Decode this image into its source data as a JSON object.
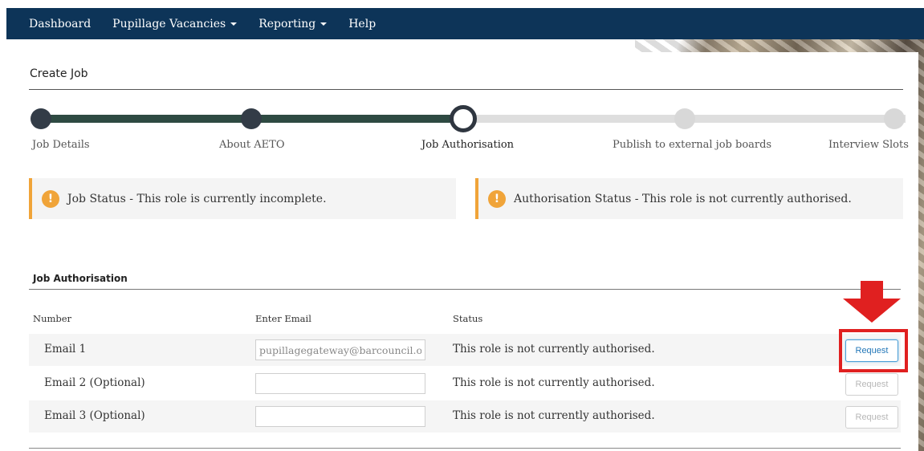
{
  "nav": {
    "items": [
      {
        "label": "Dashboard",
        "dropdown": false
      },
      {
        "label": "Pupillage Vacancies",
        "dropdown": true
      },
      {
        "label": "Reporting",
        "dropdown": true
      },
      {
        "label": "Help",
        "dropdown": false
      }
    ]
  },
  "page": {
    "title": "Create Job"
  },
  "stepper": {
    "steps": [
      {
        "label": "Job Details",
        "state": "done"
      },
      {
        "label": "About AETO",
        "state": "done"
      },
      {
        "label": "Job Authorisation",
        "state": "current"
      },
      {
        "label": "Publish to external job boards",
        "state": "todo"
      },
      {
        "label": "Interview Slots",
        "state": "todo"
      }
    ]
  },
  "alerts": {
    "job_status": "Job Status - This role is currently incomplete.",
    "auth_status": "Authorisation Status - This role is not currently authorised."
  },
  "authorisation": {
    "section_title": "Job Authorisation",
    "columns": {
      "number": "Number",
      "email": "Enter Email",
      "status": "Status"
    },
    "rows": [
      {
        "label": "Email 1",
        "email": "pupillagegateway@barcouncil.org",
        "status": "This role is not currently authorised.",
        "button": "Request",
        "enabled": true
      },
      {
        "label": "Email 2 (Optional)",
        "email": "",
        "status": "This role is not currently authorised.",
        "button": "Request",
        "enabled": false
      },
      {
        "label": "Email 3 (Optional)",
        "email": "",
        "status": "This role is not currently authorised.",
        "button": "Request",
        "enabled": false
      }
    ]
  },
  "colors": {
    "navbar": "#0d3458",
    "alert_accent": "#f0a439",
    "highlight": "#e02020",
    "button_active": "#2377b8"
  },
  "icons": {
    "alert": "exclamation-circle-icon",
    "arrow": "arrow-down-icon",
    "caret": "caret-down-icon"
  }
}
